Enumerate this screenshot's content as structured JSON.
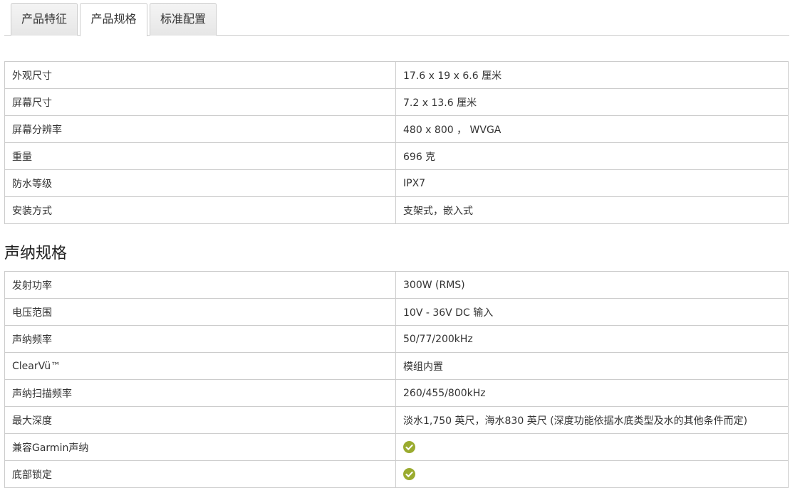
{
  "tabs": [
    {
      "label": "产品特征",
      "active": false
    },
    {
      "label": "产品规格",
      "active": true
    },
    {
      "label": "标准配置",
      "active": false
    }
  ],
  "general_specs": [
    {
      "label": "外观尺寸",
      "value": "17.6 x 19 x 6.6 厘米"
    },
    {
      "label": "屏幕尺寸",
      "value": "7.2 x 13.6 厘米"
    },
    {
      "label": "屏幕分辨率",
      "value": "480 x 800 ， WVGA"
    },
    {
      "label": "重量",
      "value": "696 克"
    },
    {
      "label": "防水等级",
      "value": "IPX7"
    },
    {
      "label": "安装方式",
      "value": "支架式，嵌入式"
    }
  ],
  "sonar_section": {
    "title": "声纳规格",
    "rows": [
      {
        "label": "发射功率",
        "value": "300W (RMS)"
      },
      {
        "label": "电压范围",
        "value": "10V - 36V DC 输入"
      },
      {
        "label": "声纳频率",
        "value": "50/77/200kHz"
      },
      {
        "label": "ClearVü™",
        "value": "模组内置"
      },
      {
        "label": "声纳扫描频率",
        "value": "260/455/800kHz"
      },
      {
        "label": "最大深度",
        "value": "淡水1,750 英尺，海水830 英尺 (深度功能依据水底类型及水的其他条件而定)"
      },
      {
        "label": "兼容Garmin声纳",
        "value_icon": "check-circle-icon"
      },
      {
        "label": "底部锁定",
        "value_icon": "check-circle-icon"
      }
    ]
  },
  "colors": {
    "check_icon": "#9aab2f",
    "border": "#cccccc",
    "text": "#333333"
  }
}
